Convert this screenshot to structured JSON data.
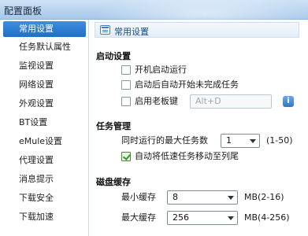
{
  "window": {
    "title": "配置面板"
  },
  "sidebar": {
    "items": [
      {
        "label": "常用设置",
        "active": true
      },
      {
        "label": "任务默认属性",
        "active": false
      },
      {
        "label": "监视设置",
        "active": false
      },
      {
        "label": "网络设置",
        "active": false
      },
      {
        "label": "外观设置",
        "active": false
      },
      {
        "label": "BT设置",
        "active": false
      },
      {
        "label": "eMule设置",
        "active": false
      },
      {
        "label": "代理设置",
        "active": false
      },
      {
        "label": "消息提示",
        "active": false
      },
      {
        "label": "下载安全",
        "active": false
      },
      {
        "label": "下载加速",
        "active": false
      }
    ]
  },
  "main": {
    "header": {
      "label": "常用设置",
      "icon": "settings-page-icon"
    },
    "startup": {
      "title": "启动设置",
      "auto_start": {
        "label": "开机启动运行",
        "checked": false
      },
      "auto_resume": {
        "label": "启动后自动开始未完成任务",
        "checked": false
      },
      "boss_key": {
        "label": "启用老板键",
        "checked": false,
        "value": "Alt+D",
        "info_icon": "info-icon"
      }
    },
    "tasks": {
      "title": "任务管理",
      "max_tasks_label": "同时运行的最大任务数",
      "max_tasks_value": "1",
      "max_tasks_range": "(1-50)",
      "move_low_speed": {
        "label": "自动将低速任务移动至列尾",
        "checked": true
      }
    },
    "cache": {
      "title": "磁盘缓存",
      "min_label": "最小缓存",
      "min_value": "8",
      "min_unit": "MB(2-16)",
      "max_label": "最大缓存",
      "max_value": "256",
      "max_unit": "MB(4-256)"
    }
  },
  "colors": {
    "accent": "#1f6fc7",
    "titlebar": "#b7d3ef",
    "check": "#2f9a2a"
  }
}
